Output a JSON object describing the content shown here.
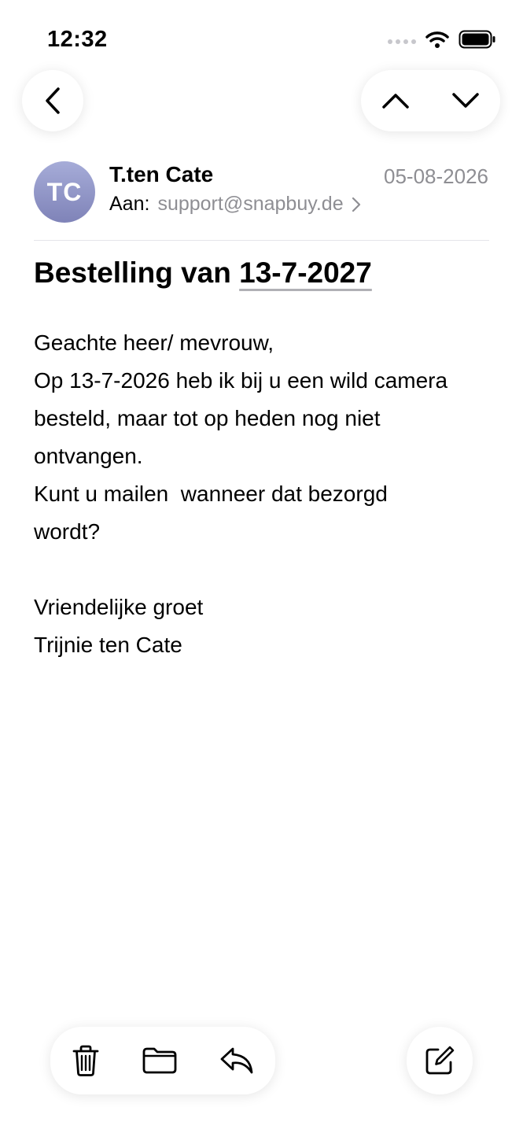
{
  "status_bar": {
    "time": "12:32",
    "icons": [
      "cellular-signal-icon",
      "wifi-icon",
      "battery-icon"
    ]
  },
  "navigation": {
    "back_icon": "chevron-left-icon",
    "previous_icon": "chevron-up-icon",
    "next_icon": "chevron-down-icon"
  },
  "message": {
    "avatar_initials": "TC",
    "sender": "T.ten Cate",
    "date": "05-08-2026",
    "to_label": "Aan:",
    "to_address": "support@snapbuy.de",
    "subject_prefix": "Bestelling van ",
    "subject_date": "13-7-2027",
    "body_lines": [
      "Geachte heer/ mevrouw,",
      "Op 13-7-2026 heb ik bij u een wild camera",
      "besteld, maar tot op heden nog niet",
      "ontvangen.",
      "Kunt u mailen  wanneer dat bezorgd",
      "wordt?",
      "",
      "Vriendelijke groet",
      "Trijnie ten Cate"
    ]
  },
  "toolbar": {
    "icons": [
      "trash-icon",
      "folder-icon",
      "reply-icon",
      "compose-icon"
    ]
  },
  "colors": {
    "secondary_text": "#8e8e93",
    "avatar_gradient_top": "#a6acd8",
    "avatar_gradient_bottom": "#7f83b8",
    "divider": "#e5e5ea"
  }
}
